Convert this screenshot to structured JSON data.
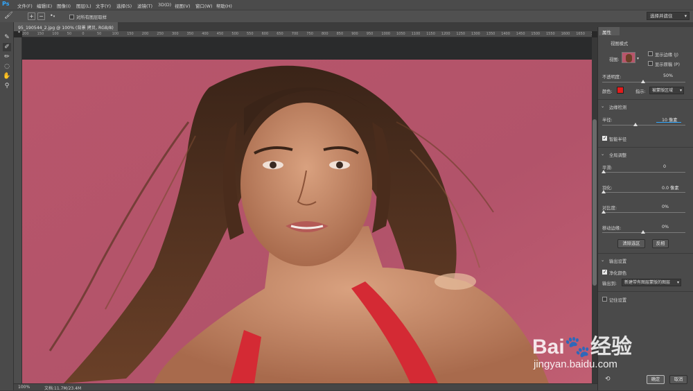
{
  "app_logo": "Ps",
  "menu": [
    "文件(F)",
    "编辑(E)",
    "图像(I)",
    "图层(L)",
    "文字(Y)",
    "选择(S)",
    "滤镜(T)",
    "3D(D)",
    "视图(V)",
    "窗口(W)",
    "帮助(H)"
  ],
  "options_bar": {
    "sample_all_layers_label": "对所有图层取样",
    "sample_all_layers_checked": false,
    "workspace_value": "选择并遮住"
  },
  "document": {
    "tab_title": "95_190544_2.jpg @ 100% (背景 拷贝, RGB/8) *",
    "zoom": "100%",
    "doc_info": "文档:11.7M/23.4M"
  },
  "ruler_ticks": [
    "200",
    "150",
    "100",
    "50",
    "0",
    "50",
    "100",
    "150",
    "200",
    "250",
    "300",
    "350",
    "400",
    "450",
    "500",
    "550",
    "600",
    "650",
    "700",
    "750",
    "800",
    "850",
    "900",
    "950",
    "1000",
    "1050",
    "1100",
    "1150",
    "1200",
    "1250",
    "1300",
    "1350",
    "1400",
    "1450",
    "1500",
    "1550",
    "1600",
    "1650",
    "1700"
  ],
  "properties": {
    "tab_label": "属性",
    "view_mode": {
      "title": "视图模式",
      "view_label": "视图:",
      "show_edge_label": "显示边缘 (J)",
      "show_edge_checked": false,
      "show_original_label": "显示原稿 (P)",
      "show_original_checked": false
    },
    "opacity_label": "不透明度:",
    "opacity_value": "50%",
    "opacity_level": 0.5,
    "color_label": "颜色:",
    "color_swatch": "#e41b1b",
    "indicate_label": "指示:",
    "indicate_value": "被蒙版区域",
    "edge_detection": {
      "title": "边缘检测",
      "radius_label": "半径:",
      "radius_value": "10 像素",
      "radius_level": 0.4,
      "smart_radius_label": "智能半径",
      "smart_radius_checked": true
    },
    "global_refine": {
      "title": "全局调整",
      "smooth_label": "平滑:",
      "smooth_value": "0",
      "feather_label": "羽化:",
      "feather_value": "0.0 像素",
      "contrast_label": "对比度:",
      "contrast_value": "0%",
      "shift_edge_label": "移动边缘:",
      "shift_edge_value": "0%",
      "shift_edge_level": 0.5,
      "clear_selection_label": "清除选区",
      "invert_label": "反相"
    },
    "output": {
      "title": "输出设置",
      "decontaminate_label": "净化颜色",
      "decontaminate_checked": true,
      "output_to_label": "输出到:",
      "output_to_value": "新建带有图层蒙版的图层",
      "remember_label": "记住设置",
      "remember_checked": false
    },
    "ok_label": "确定",
    "cancel_label": "取消"
  },
  "watermark": {
    "brand": "Bai",
    "brand_tail": "经验",
    "url": "jingyan.baidu.com"
  }
}
